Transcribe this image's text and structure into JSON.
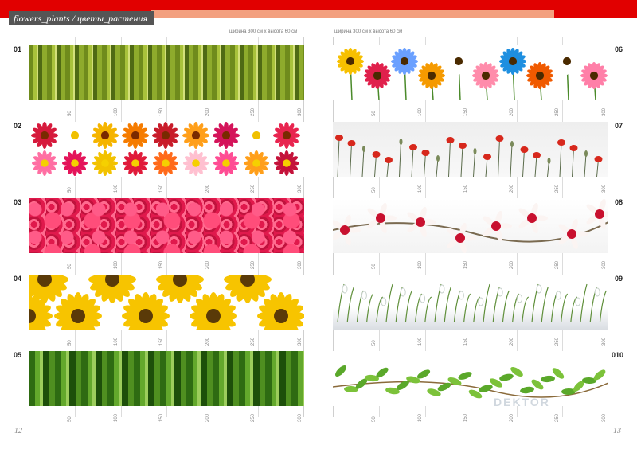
{
  "header": {
    "title": "flowers_plants / цветы_растения",
    "dim_left": "ширина 300 см х высота 60 см",
    "dim_right": "ширина 300 см х высота 60 см"
  },
  "ticks": [
    "50",
    "100",
    "150",
    "200",
    "250",
    "300"
  ],
  "left_rows": [
    {
      "num": "01",
      "theme": "bamboo"
    },
    {
      "num": "02",
      "theme": "flowers"
    },
    {
      "num": "03",
      "theme": "pink"
    },
    {
      "num": "04",
      "theme": "sunflowers"
    },
    {
      "num": "05",
      "theme": "greenbamboo"
    }
  ],
  "right_rows": [
    {
      "num": "06",
      "theme": "gerbera"
    },
    {
      "num": "07",
      "theme": "poppies"
    },
    {
      "num": "08",
      "theme": "orchids"
    },
    {
      "num": "09",
      "theme": "snowdrops"
    },
    {
      "num": "010",
      "theme": "leaves"
    }
  ],
  "watermark": "DEKTOR",
  "page_left": "12",
  "page_right": "13",
  "colors": {
    "accent": "#e10000",
    "sub_accent": "#f3a07f",
    "title_bg": "#555555"
  }
}
